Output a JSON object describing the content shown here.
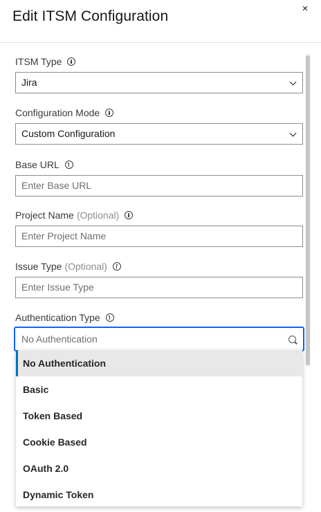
{
  "dialog": {
    "title": "Edit ITSM Configuration",
    "close_glyph": "×"
  },
  "fields": {
    "itsm_type": {
      "label": "ITSM Type",
      "value": "Jira"
    },
    "configuration_mode": {
      "label": "Configuration Mode",
      "value": "Custom Configuration"
    },
    "base_url": {
      "label": "Base URL",
      "placeholder": "Enter Base URL"
    },
    "project_name": {
      "label": "Project Name",
      "optional": "(Optional)",
      "placeholder": "Enter Project Name"
    },
    "issue_type": {
      "label": "Issue Type",
      "optional": "(Optional)",
      "placeholder": "Enter Issue Type"
    },
    "authentication_type": {
      "label": "Authentication Type",
      "placeholder": "No Authentication"
    }
  },
  "auth_menu": {
    "options": [
      "No Authentication",
      "Basic",
      "Token Based",
      "Cookie Based",
      "OAuth 2.0",
      "Dynamic Token"
    ],
    "highlighted": "No Authentication"
  },
  "colors": {
    "focus_border": "#0f62fe",
    "highlight_bar": "#0072c3"
  },
  "icons": {
    "close": "close-icon",
    "info": "info-icon",
    "dropdown": "chevron-down-icon",
    "search": "search-icon"
  }
}
